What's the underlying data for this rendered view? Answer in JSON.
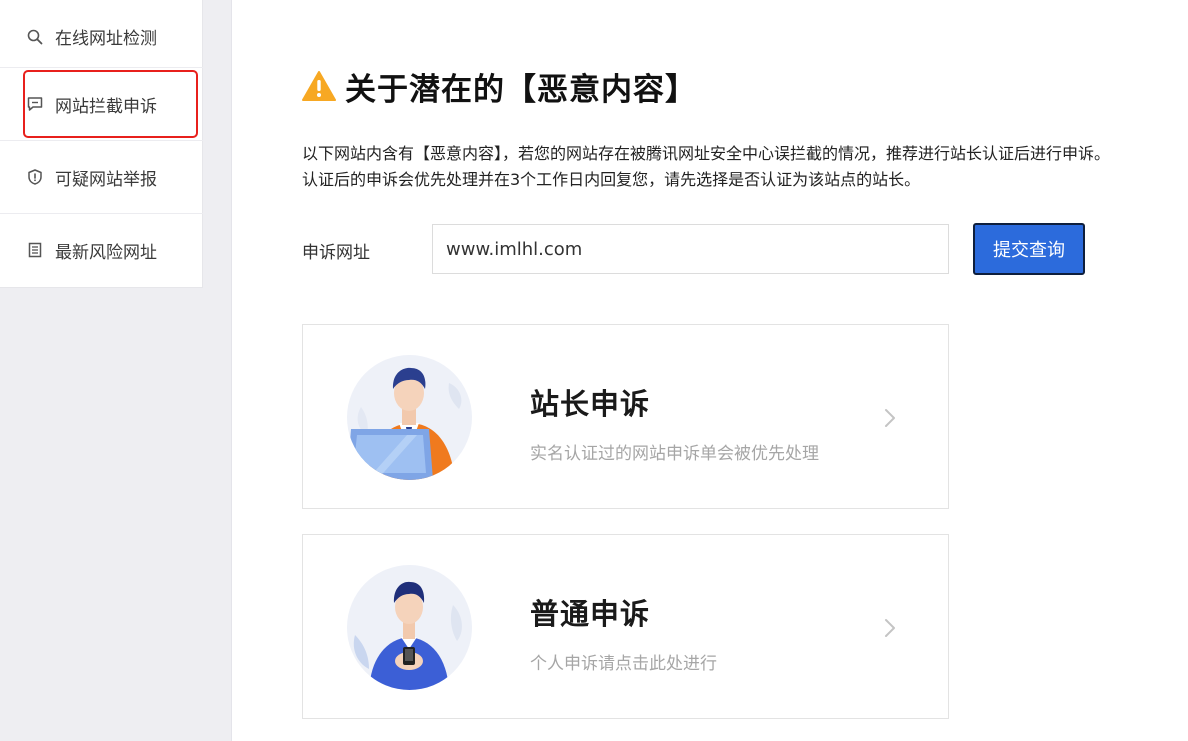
{
  "sidebar": {
    "items": [
      {
        "label": "在线网址检测",
        "icon": "search-icon"
      },
      {
        "label": "网站拦截申诉",
        "icon": "message-icon"
      },
      {
        "label": "可疑网站举报",
        "icon": "shield-icon"
      },
      {
        "label": "最新风险网址",
        "icon": "list-icon"
      }
    ]
  },
  "main": {
    "title": "关于潜在的【恶意内容】",
    "description_line1": "以下网站内含有【恶意内容】，若您的网站存在被腾讯网址安全中心误拦截的情况，推荐进行站长认证后进行申诉。",
    "description_line2": "认证后的申诉会优先处理并在3个工作日内回复您，请先选择是否认证为该站点的站长。",
    "form": {
      "label": "申诉网址",
      "url_value": "www.imlhl.com",
      "submit_label": "提交查询"
    },
    "cards": [
      {
        "title": "站长申诉",
        "subtitle": "实名认证过的网站申诉单会被优先处理"
      },
      {
        "title": "普通申诉",
        "subtitle": "个人申诉请点击此处进行"
      }
    ]
  },
  "colors": {
    "accent": "#2c6bdc",
    "highlight": "#e8201c",
    "warning": "#f7a823"
  }
}
